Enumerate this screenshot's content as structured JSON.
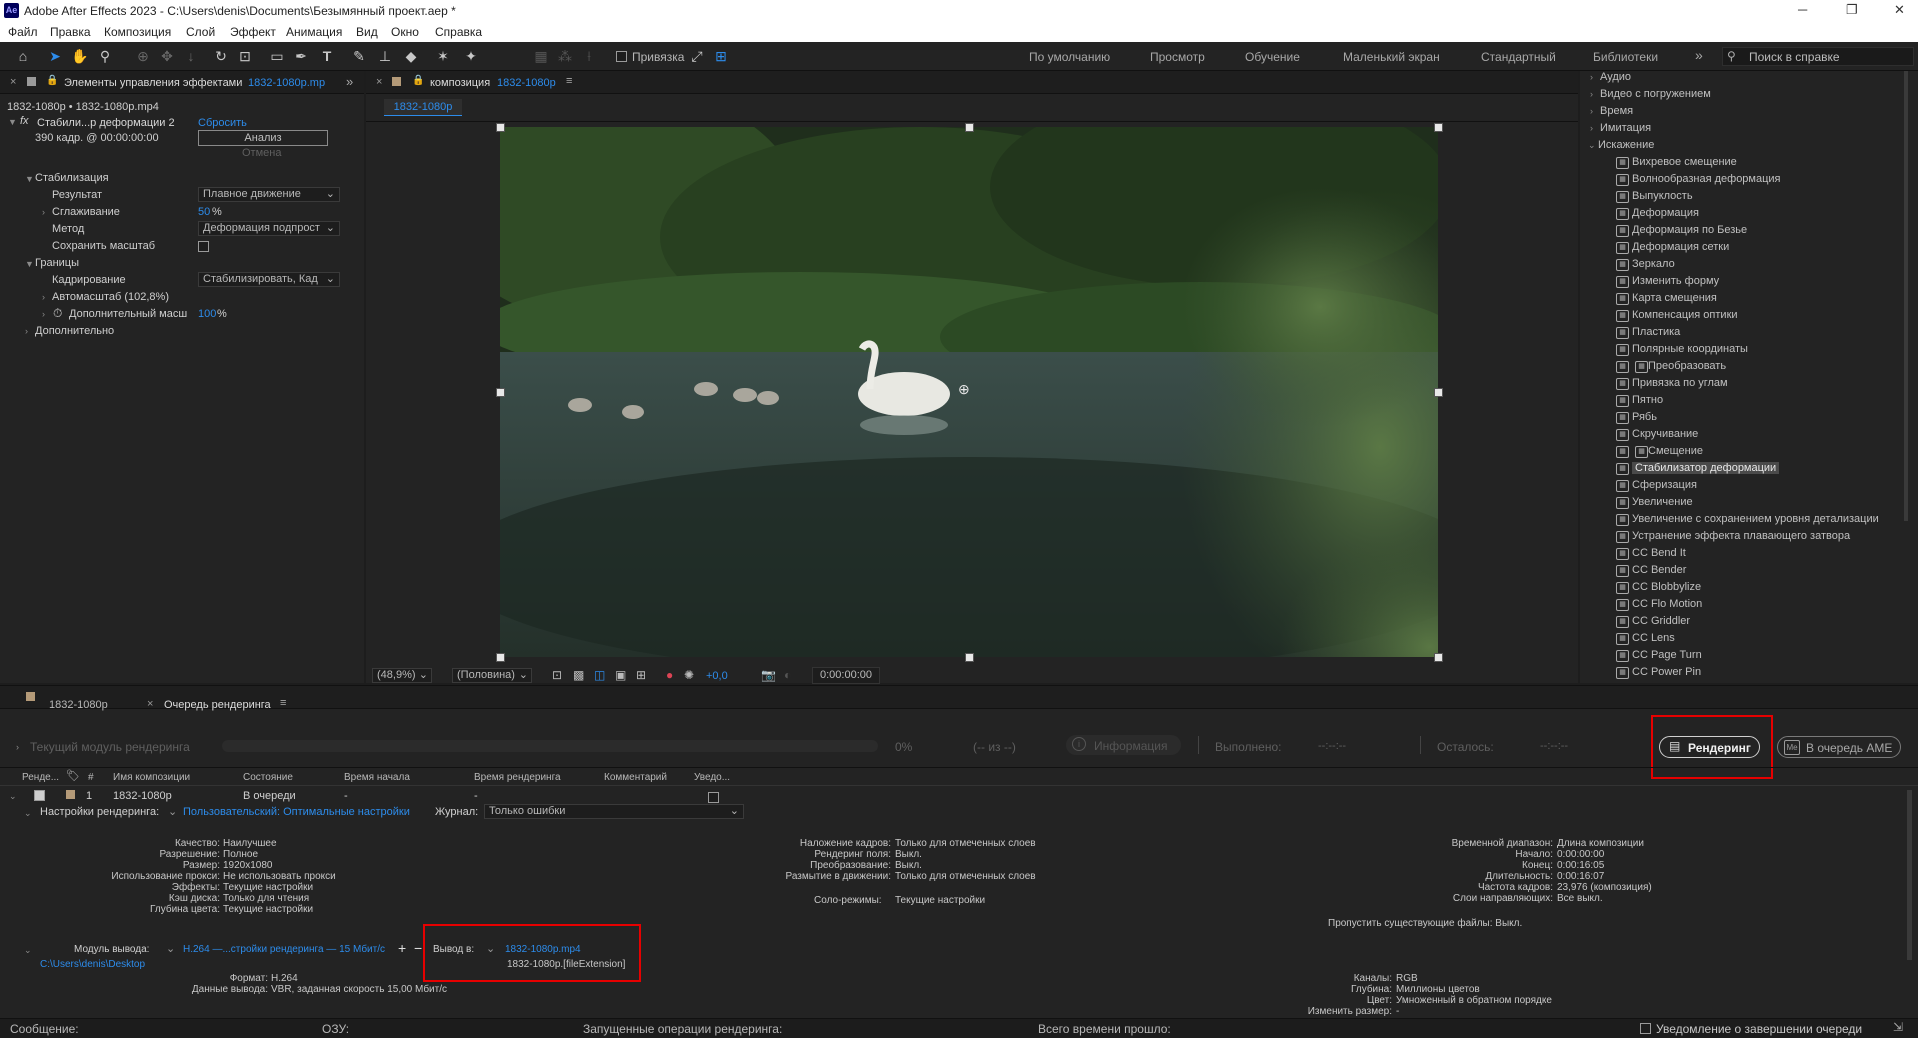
{
  "window": {
    "title": "Adobe After Effects 2023 - C:\\Users\\denis\\Documents\\Безымянный проект.aep *",
    "app_icon": "Ae"
  },
  "menu": [
    "Файл",
    "Правка",
    "Композиция",
    "Слой",
    "Эффект",
    "Анимация",
    "Вид",
    "Окно",
    "Справка"
  ],
  "toolbar": {
    "snap_label": "Привязка",
    "workspaces": [
      "По умолчанию",
      "Просмотр",
      "Обучение",
      "Маленький экран",
      "Стандартный",
      "Библиотеки"
    ],
    "search_placeholder": "Поиск в справке"
  },
  "effect_controls": {
    "tab_label": "Элементы управления эффектами",
    "tab_source": "1832-1080p.mp",
    "breadcrumb": "1832-1080p • 1832-1080p.mp4",
    "effect_name": "Стабили...р деформации 2",
    "reset_label": "Сбросить",
    "frame_info": "390 кадр. @ 00:00:00:00",
    "analyze_label": "Анализ",
    "cancel_label": "Отмена",
    "stabilization_label": "Стабилизация",
    "result_label": "Результат",
    "result_value": "Плавное движение",
    "smoothness_label": "Сглаживание",
    "smoothness_value": "50",
    "smoothness_unit": "%",
    "method_label": "Метод",
    "method_value": "Деформация подпрост",
    "preserve_scale_label": "Сохранить масштаб",
    "borders_label": "Границы",
    "framing_label": "Кадрирование",
    "framing_value": "Стабилизировать, Кад",
    "autoscale_label": "Автомасштаб (102,8%)",
    "extra_scale_label": "Дополнительный масш",
    "extra_scale_value": "100",
    "extra_scale_unit": "%",
    "advanced_label": "Дополнительно"
  },
  "composition": {
    "tab_label": "композиция",
    "tab_name": "1832-1080p",
    "sub_tab": "1832-1080p",
    "zoom": "(48,9%)",
    "resolution": "(Половина)",
    "exposure": "+0,0",
    "timecode": "0:00:00:00"
  },
  "effects_panel": {
    "categories": [
      "Аудио",
      "Видео с погружением",
      "Время",
      "Имитация",
      "Искажение"
    ],
    "items": [
      "Вихревое смещение",
      "Волнообразная деформация",
      "Выпуклость",
      "Деформация",
      "Деформация по Безье",
      "Деформация сетки",
      "Зеркало",
      "Изменить форму",
      "Карта смещения",
      "Компенсация оптики",
      "Пластика",
      "Полярные координаты",
      "Преобразовать",
      "Привязка по углам",
      "Пятно",
      "Рябь",
      "Скручивание",
      "Смещение",
      "Стабилизатор деформации",
      "Сферизация",
      "Увеличение",
      "Увеличение с сохранением уровня детализации",
      "Устранение эффекта плавающего затвора",
      "CC Bend It",
      "CC Bender",
      "CC Blobbylize",
      "CC Flo Motion",
      "CC Griddler",
      "CC Lens",
      "CC Page Turn",
      "CC Power Pin"
    ],
    "selected": "Стабилизатор деформации"
  },
  "bottom_tabs": {
    "timeline_tab": "1832-1080p",
    "render_tab": "Очередь рендеринга"
  },
  "render_status": {
    "current_module": "Текущий модуль рендеринга",
    "percent": "0%",
    "count": "(-- из --)",
    "info_label": "Информация",
    "done_label": "Выполнено:",
    "done_value": "--:--:--",
    "remaining_label": "Осталось:",
    "remaining_value": "--:--:--",
    "render_button": "Рендеринг",
    "ame_button": "В очередь AME"
  },
  "queue_columns": [
    "Ренде...",
    "#",
    "Имя композиции",
    "Состояние",
    "Время начала",
    "Время рендеринга",
    "Комментарий",
    "Уведо..."
  ],
  "queue_item": {
    "number": "1",
    "name": "1832-1080p",
    "status": "В очереди",
    "start_time": "-",
    "render_time": "-",
    "render_settings_label": "Настройки рендеринга:",
    "render_settings_value": "Пользовательский: Оптимальные настройки",
    "log_label": "Журнал:",
    "log_value": "Только ошибки",
    "output_module_label": "Модуль вывода:",
    "output_module_value": "H.264 —...стройки рендеринга — 15 Мбит/с",
    "output_to_label": "Вывод в:",
    "output_file": "1832-1080p.mp4",
    "output_path": "C:\\Users\\denis\\Desktop",
    "output_template": "1832-1080p.[fileExtension]"
  },
  "settings_left": [
    [
      "Качество:",
      "Наилучшее"
    ],
    [
      "Разрешение:",
      "Полное"
    ],
    [
      "Размер:",
      "1920x1080"
    ],
    [
      "Использование прокси:",
      "Не использовать прокси"
    ],
    [
      "Эффекты:",
      "Текущие настройки"
    ],
    [
      "Кэш диска:",
      "Только для чтения"
    ],
    [
      "Глубина цвета:",
      "Текущие настройки"
    ]
  ],
  "settings_mid": [
    [
      "Наложение кадров:",
      "Только для отмеченных слоев"
    ],
    [
      "Рендеринг поля:",
      "Выкл."
    ],
    [
      "Преобразование:",
      "Выкл."
    ],
    [
      "Размытие в движении:",
      "Только для отмеченных слоев"
    ]
  ],
  "solo_label": "Соло-режимы:",
  "solo_value": "Текущие настройки",
  "settings_right": [
    [
      "Временной диапазон:",
      "Длина композиции"
    ],
    [
      "Начало:",
      "0:00:00:00"
    ],
    [
      "Конец:",
      "0:00:16:05"
    ],
    [
      "Длительность:",
      "0:00:16:07"
    ],
    [
      "Частота кадров:",
      "23,976 (композиция)"
    ],
    [
      "Слои направляющих:",
      "Все выкл."
    ]
  ],
  "skip_existing": "Пропустить существующие файлы:  Выкл.",
  "output_left": [
    [
      "Формат:",
      "H.264"
    ],
    [
      "Данные вывода:",
      "VBR, заданная скорость 15,00 Мбит/с"
    ]
  ],
  "output_right": [
    [
      "Каналы:",
      "RGB"
    ],
    [
      "Глубина:",
      "Миллионы цветов"
    ],
    [
      "Цвет:",
      "Умноженный в обратном порядке"
    ],
    [
      "Изменить размер:",
      "-"
    ]
  ],
  "statusbar": {
    "message": "Сообщение:",
    "ram": "ОЗУ:",
    "running": "Запущенные операции рендеринга:",
    "elapsed": "Всего времени прошло:",
    "notify": "Уведомление о завершении очереди"
  }
}
